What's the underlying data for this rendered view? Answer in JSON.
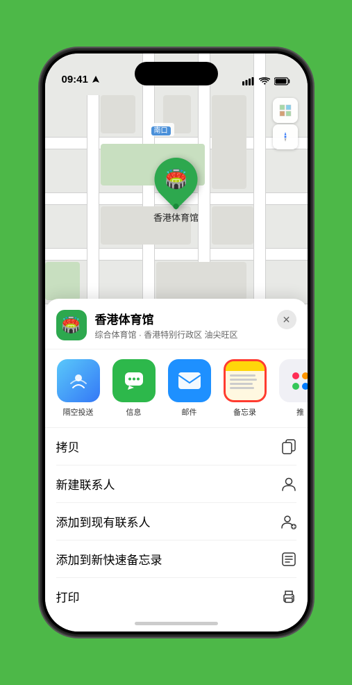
{
  "status": {
    "time": "09:41",
    "location_arrow": true
  },
  "map": {
    "label_north": "南口",
    "location_name": "香港体育馆",
    "venue_sub": "综合体育馆 · 香港特别行政区 油尖旺区"
  },
  "share_items": [
    {
      "id": "airdrop",
      "label": "隔空投送",
      "type": "airdrop"
    },
    {
      "id": "message",
      "label": "信息",
      "type": "message"
    },
    {
      "id": "mail",
      "label": "邮件",
      "type": "mail"
    },
    {
      "id": "notes",
      "label": "备忘录",
      "type": "notes"
    },
    {
      "id": "more",
      "label": "推",
      "type": "more"
    }
  ],
  "actions": [
    {
      "id": "copy",
      "label": "拷贝",
      "icon": "copy"
    },
    {
      "id": "new-contact",
      "label": "新建联系人",
      "icon": "person"
    },
    {
      "id": "add-existing",
      "label": "添加到现有联系人",
      "icon": "person-add"
    },
    {
      "id": "add-notes",
      "label": "添加到新快速备忘录",
      "icon": "note"
    },
    {
      "id": "print",
      "label": "打印",
      "icon": "printer"
    }
  ]
}
